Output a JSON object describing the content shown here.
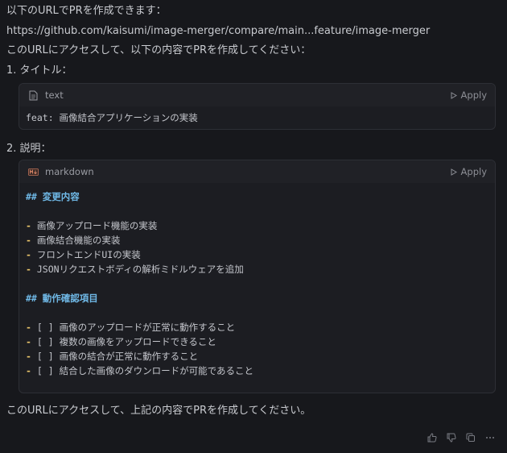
{
  "intro": "以下のURLでPRを作成できます：",
  "url": "https://github.com/kaisumi/image-merger/compare/main...feature/image-merger",
  "access_line": "このURLにアクセスして、以下の内容でPRを作成してください：",
  "item1_label": "1. タイトル：",
  "block1": {
    "lang": "text",
    "apply_label": "Apply",
    "code": "feat: 画像結合アプリケーションの実装"
  },
  "item2_label": "2. 説明：",
  "block2": {
    "lang": "markdown",
    "apply_label": "Apply",
    "heading1": "## 変更内容",
    "list1": [
      "画像アップロード機能の実装",
      "画像結合機能の実装",
      "フロントエンドUIの実装",
      "JSONリクエストボディの解析ミドルウェアを追加"
    ],
    "heading2": "## 動作確認項目",
    "list2": [
      "画像のアップロードが正常に動作すること",
      "複数の画像をアップロードできること",
      "画像の結合が正常に動作すること",
      "結合した画像のダウンロードが可能であること"
    ],
    "checkbox": "[ ]",
    "dash": "-"
  },
  "closing": "このURLにアクセスして、上記の内容でPRを作成してください。",
  "footer_icons": [
    "thumbs-up-icon",
    "thumbs-down-icon",
    "copy-icon",
    "more-icon"
  ]
}
